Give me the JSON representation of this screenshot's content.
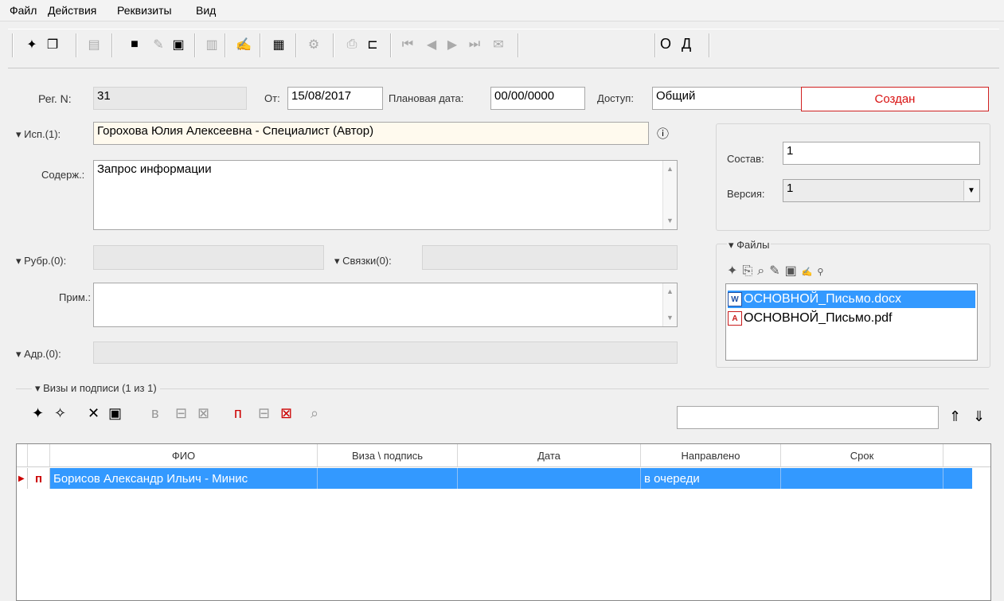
{
  "menu": {
    "items": [
      "Файл",
      "Действия",
      "Реквизиты",
      "Вид"
    ]
  },
  "toolbar": {
    "toggle_o": "О",
    "toggle_d": "Д"
  },
  "form": {
    "reg_label": "Рег. N:",
    "reg_value": "31",
    "date_label": "От:",
    "date_value": "15/08/2017",
    "plan_label": "Плановая дата:",
    "plan_value": "00/00/0000",
    "access_label": "Доступ:",
    "access_value": "Общий",
    "status": "Создан",
    "isp_label": "Исп.(1):",
    "isp_value": "Горохова Юлия Алексеевна - Специалист (Автор)",
    "content_label": "Содерж.:",
    "content_value": "Запрос информации",
    "rubr_label": "Рубр.(0):",
    "links_label": "Связки(0):",
    "note_label": "Прим.:",
    "addr_label": "Адр.(0):"
  },
  "side": {
    "sostav_label": "Состав:",
    "sostav_value": "1",
    "version_label": "Версия:",
    "version_value": "1"
  },
  "files": {
    "title": "Файлы",
    "items": [
      {
        "name": "ОСНОВНОЙ_Письмо.docx",
        "icon": "word-file-icon"
      },
      {
        "name": "ОСНОВНОЙ_Письмо.pdf",
        "icon": "pdf-file-icon"
      }
    ]
  },
  "visas": {
    "title": "Визы и подписи (1 из 1)",
    "columns": [
      "ФИО",
      "Виза \\ подпись",
      "Дата",
      "Направлено",
      "Срок"
    ],
    "rows": [
      {
        "marker": "п",
        "fio": "Борисов Александр Ильич - Минис",
        "visa": "",
        "date": "",
        "sent": "в очереди",
        "due": ""
      }
    ]
  },
  "colors": {
    "selection": "#3399ff",
    "status_red": "#d81010"
  }
}
